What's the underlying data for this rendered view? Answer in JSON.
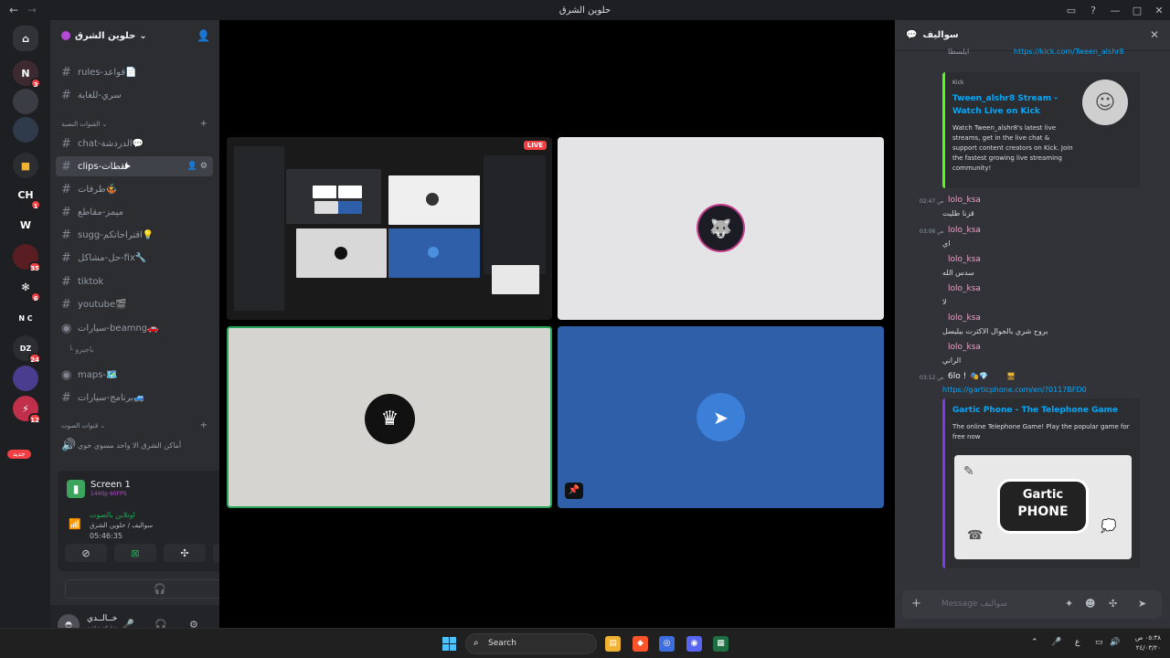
{
  "window": {
    "title": "حلوين الشرق",
    "back": "←",
    "forward": "→"
  },
  "server": {
    "name": "حلوين الشرق"
  },
  "channels": [
    {
      "name": "rules-قواعد",
      "emoji": "📄",
      "type": "text"
    },
    {
      "name": "سري-للغاية",
      "emoji": "",
      "type": "text"
    },
    {
      "name": "chat-الدردشة",
      "emoji": "💬",
      "type": "text"
    },
    {
      "name": "clips-لقطات",
      "emoji": "",
      "type": "text",
      "selected": true
    },
    {
      "name": "ظرفات",
      "emoji": "🤹",
      "type": "text"
    },
    {
      "name": "ميمز-مقاطع",
      "emoji": "",
      "type": "text"
    },
    {
      "name": "sugg-اقتراحاتكم",
      "emoji": "💡",
      "type": "text"
    },
    {
      "name": "حل-مشاكل-fix",
      "emoji": "🔧",
      "type": "text"
    },
    {
      "name": "tiktok",
      "emoji": "",
      "type": "text"
    },
    {
      "name": "youtube",
      "emoji": "🎬",
      "type": "text"
    },
    {
      "name": "سيارات-beamng",
      "emoji": "🚗",
      "type": "forum"
    },
    {
      "name": "maps-",
      "emoji": "🗺️",
      "type": "forum"
    },
    {
      "name": "برنامج-سيارات",
      "emoji": "🚙",
      "type": "text"
    }
  ],
  "sub_channel": "باجيرو",
  "categories": {
    "text": "القنوات النصية",
    "voice": "قنوات الصوت"
  },
  "voice_channel_peek": "أماكن الشرق الا واحد مسوي خوي",
  "voice_panel": {
    "screen_name": "Screen 1",
    "quality": "1440p 60FPS",
    "status": "اونلاين بالصوت",
    "location": "سواليف / حلوين الشرق",
    "timer": "05:46:35"
  },
  "user": {
    "name": "خــالــدي",
    "status": "مشاركة شاشة"
  },
  "guild_badges": [
    "3",
    "1",
    "35",
    "6",
    "24",
    "12"
  ],
  "new_label": "جديد",
  "stage": {
    "live_label": "LIVE"
  },
  "chat": {
    "channel": "سواليف",
    "message_placeholder": "Message سواليف",
    "messages": [
      {
        "time": "02:47 ص",
        "author": "lolo_ksa",
        "text": "قزنا طليت"
      },
      {
        "time": "03:06 ص",
        "author": "lolo_ksa",
        "text": "اي"
      },
      {
        "time": "",
        "author": "lolo_ksa",
        "text": "سدس الله"
      },
      {
        "time": "",
        "author": "lolo_ksa",
        "text": "لا"
      },
      {
        "time": "",
        "author": "lolo_ksa",
        "text": "بروح شري بالجوال الاكثرت بيليسل"
      },
      {
        "time": "",
        "author": "lolo_ksa",
        "text": "الراني"
      }
    ],
    "kick_embed": {
      "top_name": "ايلسطا",
      "top_link": "https://kick.com/Tween_alshr8",
      "provider": "Kick",
      "title": "Tween_alshr8 Stream - Watch Live on Kick",
      "description": "Watch Tween_alshr8's latest live streams, get in the live chat & support content creators on Kick. Join the fastest growing live streaming community!"
    },
    "gartic": {
      "time": "03:12 ص",
      "author": "6lo !",
      "link": "https://garticphone.com/en/?0117BFD0",
      "title": "Gartic Phone - The Telephone Game",
      "description": "The online Telephone Game! Play the popular game for free now",
      "image_line1": "Gartic",
      "image_line2": "PHONE"
    }
  },
  "taskbar": {
    "search_label": "Search",
    "clock_time": "٠٥:٣٨ ص",
    "clock_date": "٢٤/٠٣/٢٠"
  },
  "colors": {
    "accent_green": "#23a55a",
    "link_blue": "#00a8fc",
    "live_red": "#f23f43",
    "kick_green": "#53fc18",
    "tile_blue": "#2f5fa8"
  }
}
